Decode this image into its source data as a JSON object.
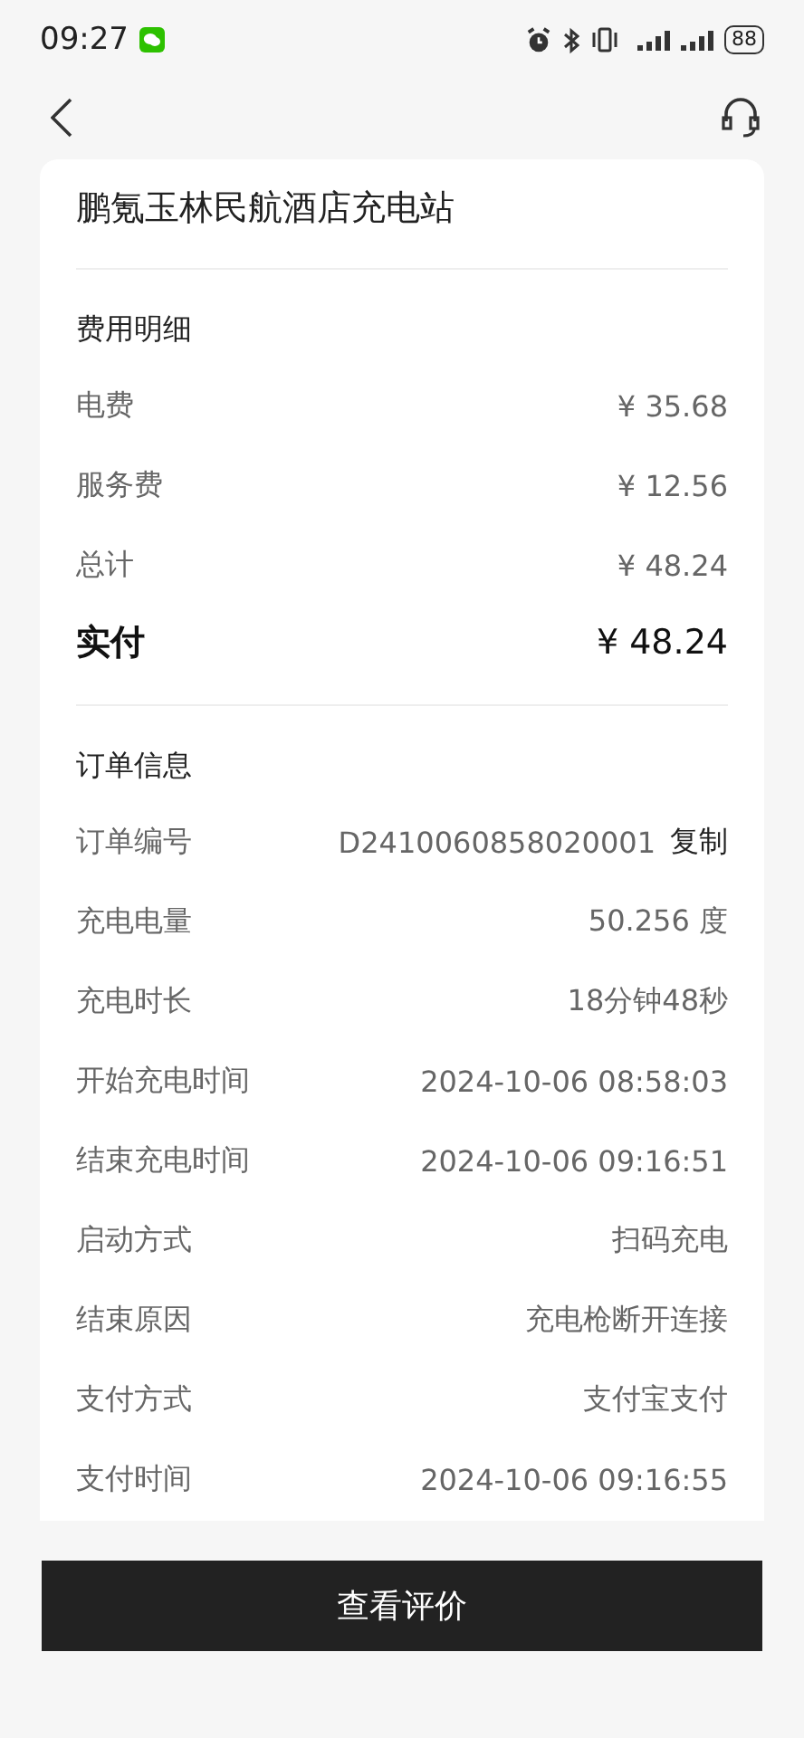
{
  "status_bar": {
    "time": "09:27",
    "battery": "88"
  },
  "station": {
    "name": "鹏氪玉林民航酒店充电站"
  },
  "fees": {
    "title": "费用明细",
    "rows": [
      {
        "label": "电费",
        "value": "¥ 35.68",
        "kind": "normal"
      },
      {
        "label": "服务费",
        "value": "¥ 12.56",
        "kind": "normal"
      },
      {
        "label": "总计",
        "value": "¥ 48.24",
        "kind": "normal"
      },
      {
        "label": "实付",
        "value": "¥ 48.24",
        "kind": "total"
      }
    ]
  },
  "order": {
    "title": "订单信息",
    "rows": [
      {
        "label": "订单编号",
        "value": "D2410060858020001",
        "action": "复制"
      },
      {
        "label": "充电电量",
        "value": "50.256 度"
      },
      {
        "label": "充电时长",
        "value": "18分钟48秒"
      },
      {
        "label": "开始充电时间",
        "value": "2024-10-06 08:58:03"
      },
      {
        "label": "结束充电时间",
        "value": "2024-10-06 09:16:51"
      },
      {
        "label": "启动方式",
        "value": "扫码充电"
      },
      {
        "label": "结束原因",
        "value": "充电枪断开连接"
      },
      {
        "label": "支付方式",
        "value": "支付宝支付"
      },
      {
        "label": "支付时间",
        "value": "2024-10-06 09:16:55"
      }
    ]
  },
  "button": {
    "label": "查看评价"
  }
}
